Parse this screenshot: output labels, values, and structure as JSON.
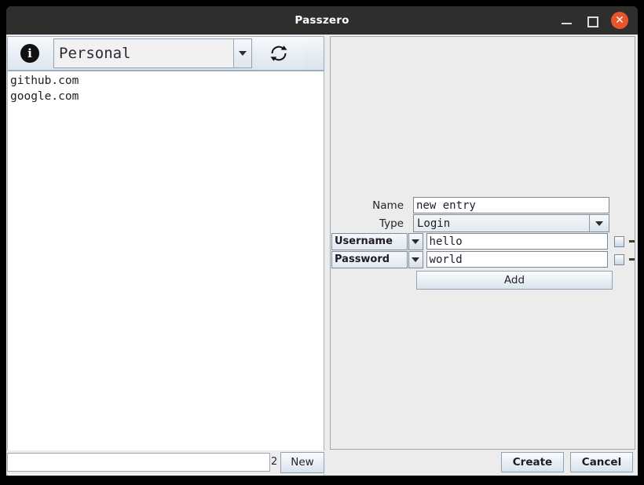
{
  "window": {
    "title": "Passzero",
    "controls": {
      "minimize": "–",
      "maximize": "□",
      "close": "✕"
    }
  },
  "left_pane": {
    "toolbar": {
      "info_icon": "info-icon",
      "vault_selector": {
        "value": "Personal",
        "icon": "chevron-down-icon"
      },
      "refresh_icon": "refresh-icon"
    },
    "entries": [
      "github.com",
      "google.com"
    ],
    "footer": {
      "filter_value": "",
      "filter_placeholder": "",
      "entry_count": "2",
      "new_label": "New"
    }
  },
  "right_pane": {
    "form": {
      "name": {
        "label": "Name",
        "value": "new entry",
        "placeholder": ""
      },
      "type": {
        "label": "Type",
        "value": "Login",
        "icon": "chevron-down-icon"
      },
      "fields": [
        {
          "name": "Username",
          "value": "hello",
          "placeholder": "",
          "checked": false,
          "icon": "chevron-down-icon",
          "remove_glyph": "-"
        },
        {
          "name": "Password",
          "value": "world",
          "placeholder": "",
          "checked": false,
          "icon": "chevron-down-icon",
          "remove_glyph": "-"
        }
      ],
      "add_label": "Add"
    },
    "footer": {
      "create_label": "Create",
      "cancel_label": "Cancel"
    }
  },
  "colors": {
    "titlebar_bg": "#2e2e2e",
    "close_button": "#e8542b",
    "panel_bg": "#ececec",
    "list_bg": "#ffffff",
    "border": "#9aa7b5"
  }
}
